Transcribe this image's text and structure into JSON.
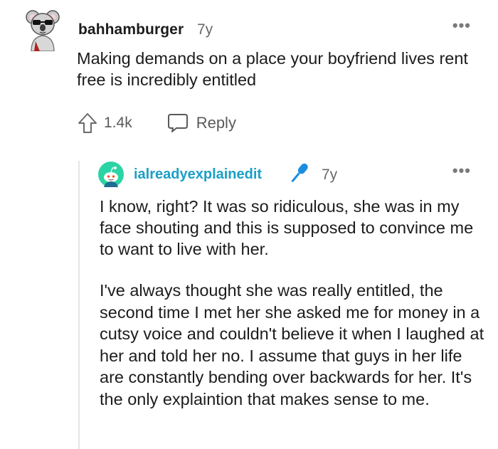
{
  "comment": {
    "username": "bahhamburger",
    "time": "7y",
    "more": "•••",
    "text": "Making demands on a place your boyfriend lives rent free is incredibly entitled",
    "upvote_count": "1.4k",
    "reply_label": "Reply",
    "icons": {
      "avatar": "koala-avatar-icon",
      "upvote": "upvote-arrow-icon",
      "reply": "speech-bubble-icon"
    }
  },
  "reply": {
    "username": "ialreadyexplainedit",
    "time": "7y",
    "more": "•••",
    "paragraph1": "I know, right? It was so ridiculous, she was in my face shouting and this is supposed to convince me to want to live with her.",
    "paragraph2": "I've always thought she was really entitled, the second time I met her she asked me for money in a cutsy voice and couldn't believe it when I laughed at her and told her no. I assume that guys in her life are constantly bending over backwards for her. It's the only explaintion that makes sense to me.",
    "icons": {
      "avatar": "snoo-avatar-icon",
      "badge": "microphone-icon"
    },
    "colors": {
      "username": "#1aa0c6",
      "avatar_bg": "#2bd4a4",
      "mic": "#1b8ee0"
    }
  }
}
